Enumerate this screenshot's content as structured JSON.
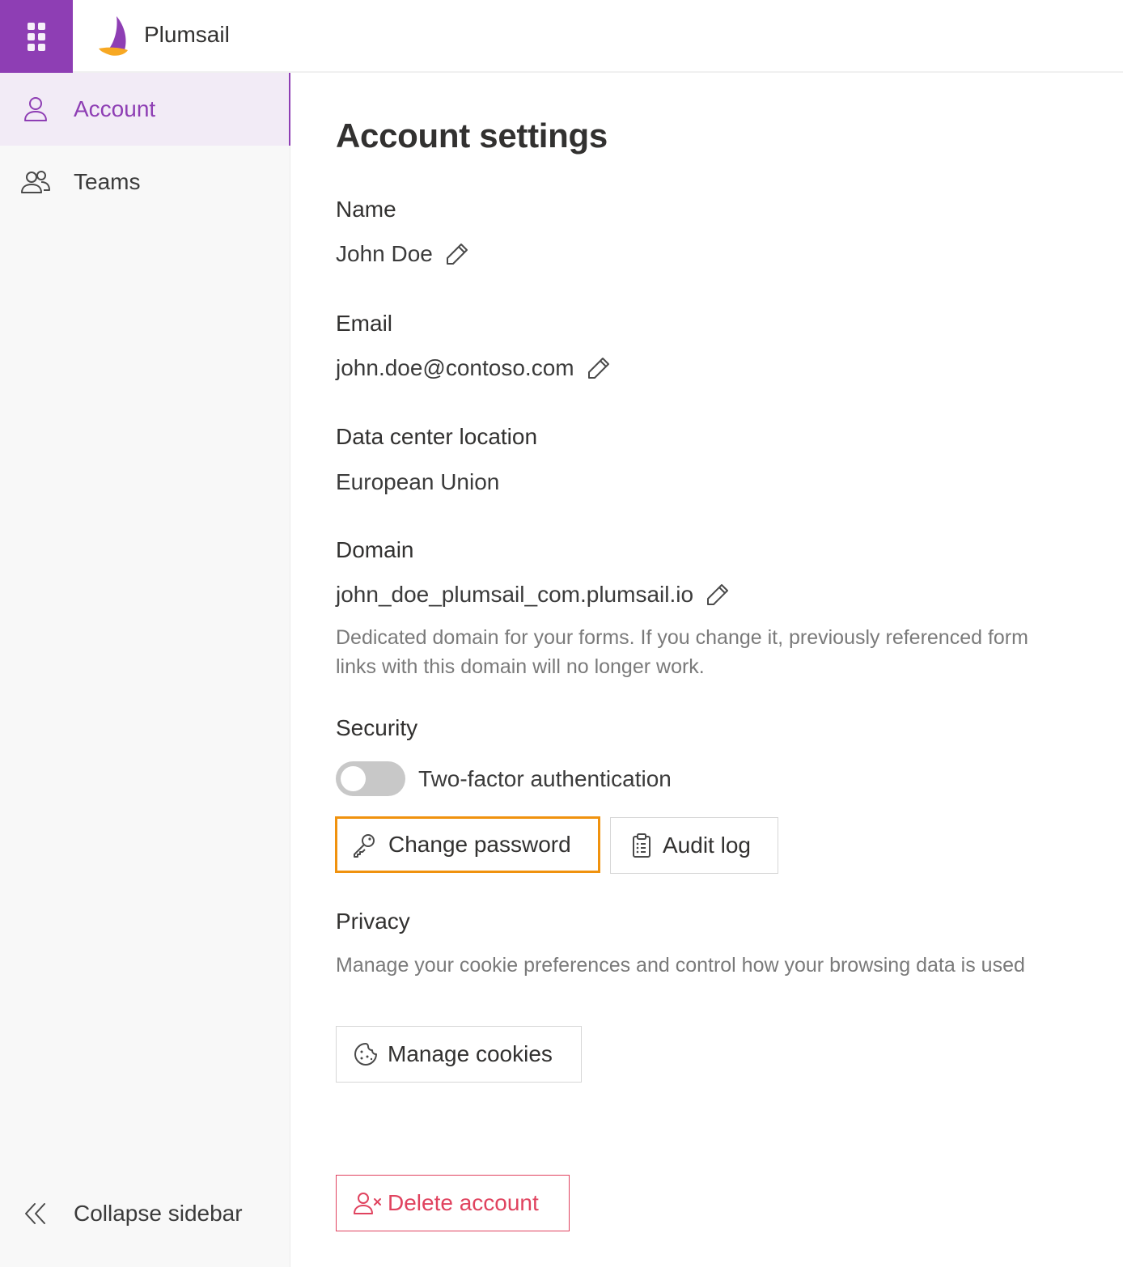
{
  "app": {
    "brand": "Plumsail"
  },
  "sidebar": {
    "items": [
      {
        "label": "Account",
        "icon": "user-icon",
        "active": true
      },
      {
        "label": "Teams",
        "icon": "people-icon",
        "active": false
      }
    ],
    "collapse_label": "Collapse sidebar"
  },
  "page": {
    "title": "Account settings",
    "name": {
      "label": "Name",
      "value": "John Doe"
    },
    "email": {
      "label": "Email",
      "value": "john.doe@contoso.com"
    },
    "data_center": {
      "label": "Data center location",
      "value": "European Union"
    },
    "domain": {
      "label": "Domain",
      "value": "john_doe_plumsail_com.plumsail.io",
      "helper": "Dedicated domain for your forms. If you change it, previously referenced form links with this domain will no longer work."
    },
    "security": {
      "label": "Security",
      "two_factor_label": "Two-factor authentication",
      "two_factor_enabled": false,
      "change_password_label": "Change password",
      "audit_log_label": "Audit log"
    },
    "privacy": {
      "label": "Privacy",
      "helper": "Manage your cookie preferences and control how your browsing data is used",
      "manage_cookies_label": "Manage cookies"
    },
    "delete_account_label": "Delete account"
  },
  "colors": {
    "brand": "#8e3eb4",
    "highlight": "#f0920e",
    "danger": "#e0435f",
    "logo_orange": "#f7a823"
  }
}
